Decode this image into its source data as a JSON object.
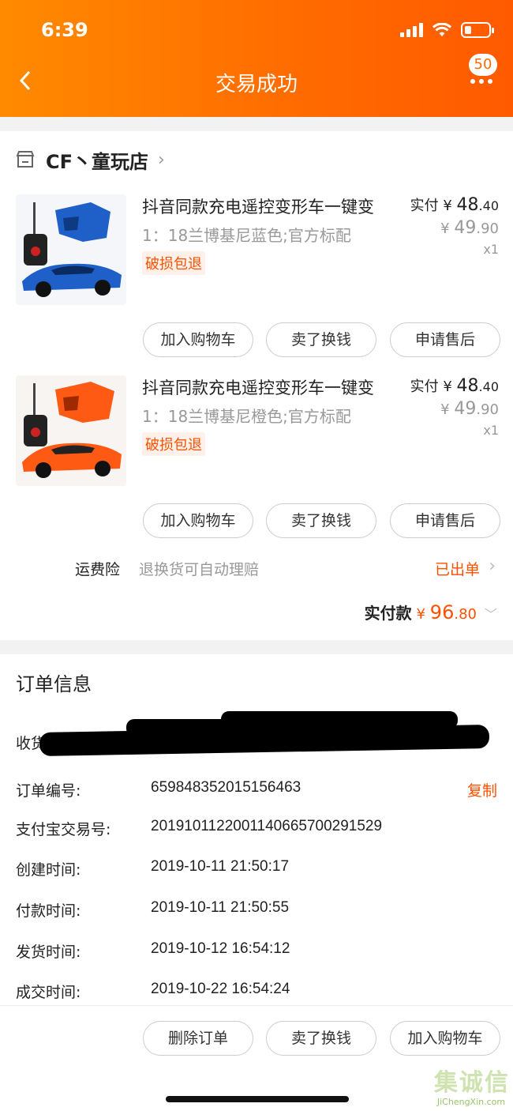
{
  "status_bar": {
    "time": "6:39"
  },
  "header": {
    "title": "交易成功",
    "badge_count": "50"
  },
  "shop": {
    "name": "CF丶童玩店"
  },
  "items": [
    {
      "title": "抖音同款充电遥控变形车一键变",
      "sku": "1：18兰博基尼蓝色;官方标配",
      "tag": "破损包退",
      "paid_label": "实付",
      "currency": "¥",
      "paid_int": "48",
      "paid_dec": ".40",
      "orig_int": "49",
      "orig_dec": ".90",
      "qty": "x1",
      "color": "#1e5fc8"
    },
    {
      "title": "抖音同款充电遥控变形车一键变",
      "sku": "1：18兰博基尼橙色;官方标配",
      "tag": "破损包退",
      "paid_label": "实付",
      "currency": "¥",
      "paid_int": "48",
      "paid_dec": ".40",
      "orig_int": "49",
      "orig_dec": ".90",
      "qty": "x1",
      "color": "#ff5a14"
    }
  ],
  "item_buttons": {
    "add_cart": "加入购物车",
    "resell": "卖了换钱",
    "after_sale": "申请售后"
  },
  "insurance": {
    "label": "运费险",
    "desc": "退换货可自动理赔",
    "status": "已出单"
  },
  "total": {
    "label": "实付款",
    "currency": "¥",
    "int": "96",
    "dec": ".80"
  },
  "order_info": {
    "title": "订单信息",
    "address_label": "收货",
    "order_no_label": "订单编号:",
    "order_no": "659848352015156463",
    "copy": "复制",
    "alipay_label": "支付宝交易号:",
    "alipay_no": "2019101122001140665700291529",
    "created_label": "创建时间:",
    "created": "2019-10-11 21:50:17",
    "paid_label": "付款时间:",
    "paid": "2019-10-11 21:50:55",
    "shipped_label": "发货时间:",
    "shipped": "2019-10-12 16:54:12",
    "closed_label": "成交时间:",
    "closed": "2019-10-22 16:54:24"
  },
  "bottom_actions": {
    "delete": "删除订单",
    "resell": "卖了换钱",
    "add_cart": "加入购物车"
  },
  "watermark": {
    "chars": [
      "集",
      "诚",
      "信"
    ],
    "url": "JiChengXin.com"
  },
  "colors": {
    "brand": "#ff6a00",
    "accent": "#ff5000"
  }
}
